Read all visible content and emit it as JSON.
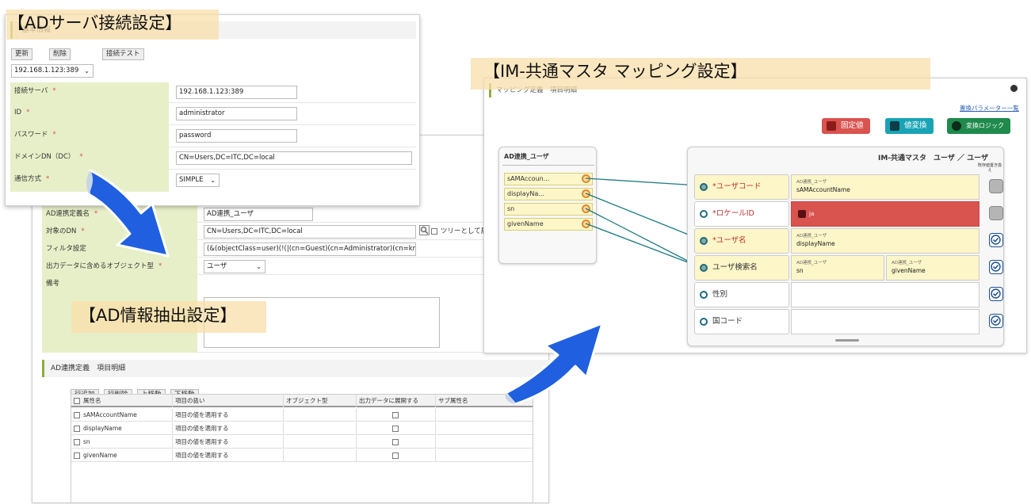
{
  "titles": {
    "server": "【ADサーバ接続設定】",
    "mapping": "【IM-共通マスタ マッピング設定】",
    "extract": "【AD情報抽出設定】"
  },
  "server_panel": {
    "section": "基本情報",
    "buttons": {
      "update": "更新",
      "delete": "削除",
      "test": "接続テスト"
    },
    "server_select": "192.168.1.123:389",
    "fields": [
      {
        "label": "接続サーバ",
        "required": "*",
        "value": "192.168.1.123:389"
      },
      {
        "label": "ID",
        "required": "*",
        "value": "administrator"
      },
      {
        "label": "パスワード",
        "required": "*",
        "value": "password"
      },
      {
        "label": "ドメインDN（DC）",
        "required": "*",
        "value": "CN=Users,DC=ITC,DC=local"
      },
      {
        "label": "通信方式",
        "required": "*",
        "value": "SIMPLE"
      }
    ]
  },
  "extract_panel": {
    "fields": [
      {
        "label": "AD連携定義名",
        "required": "*",
        "value": "AD連携_ユーザ"
      },
      {
        "label": "対象のDN",
        "required": "*",
        "value": "CN=Users,DC=ITC,DC=local"
      },
      {
        "label": "フィルタ設定",
        "required": "",
        "value": "(&(objectClass=user)(!(|(cn=Guest)(cn=Administrator)(cn=krbtgt)(cn=I"
      },
      {
        "label": "出力データに含めるオブジェクト型",
        "required": "*",
        "value": "ユーザ"
      },
      {
        "label": "備考",
        "required": "",
        "value": ""
      }
    ],
    "tree_label": "ツリーとして展開",
    "section": "AD連携定義　項目明細",
    "buttons": {
      "add": "行追加",
      "remove": "行削除",
      "up": "上移動",
      "down": "下移動"
    },
    "columns": [
      "属性名",
      "項目の扱い",
      "オブジェクト型",
      "出力データに展開する",
      "サブ属性名"
    ],
    "rows": [
      {
        "name": "sAMAccountName",
        "mode": "項目の値を適用する"
      },
      {
        "name": "displayName",
        "mode": "項目の値を適用する"
      },
      {
        "name": "sn",
        "mode": "項目の値を適用する"
      },
      {
        "name": "givenName",
        "mode": "項目の値を適用する"
      }
    ]
  },
  "mapping_panel": {
    "header": "マッピング定義　項目明細",
    "param_link": "置換パラメーター一覧",
    "buttons": {
      "fixed": "固定値",
      "convert": "値変換",
      "logic": "変換ロジック"
    },
    "ad_title": "AD連携_ユーザ",
    "ad_items": [
      "sAMAccoun...",
      "displayNa...",
      "sn",
      "givenName"
    ],
    "im_title": "IM-共通マスタ　ユーザ ／ ユーザ",
    "col_header": "既存値置き換え",
    "rows": [
      {
        "label": "*ユーザコード",
        "source": "AD連携_ユーザ",
        "value": "sAMAccountName"
      },
      {
        "label": "*ロケールID",
        "fixed": "ja"
      },
      {
        "label": "*ユーザ名",
        "source": "AD連携_ユーザ",
        "value": "displayName"
      },
      {
        "label": "ユーザ検索名",
        "source": "AD連携_ユーザ",
        "value": "sn",
        "source2": "AD連携_ユーザ",
        "value2": "givenName"
      },
      {
        "label": "性別"
      },
      {
        "label": "国コード"
      }
    ]
  },
  "colors": {
    "label_bg": "#e7efc8",
    "accent_green": "#8cae3c",
    "fixed_red": "#d9534f",
    "convert_teal": "#1aa3b5",
    "logic_green": "#1e8a4c",
    "line_teal": "#1e7b85",
    "arrow_blue": "#1f5fe0"
  }
}
